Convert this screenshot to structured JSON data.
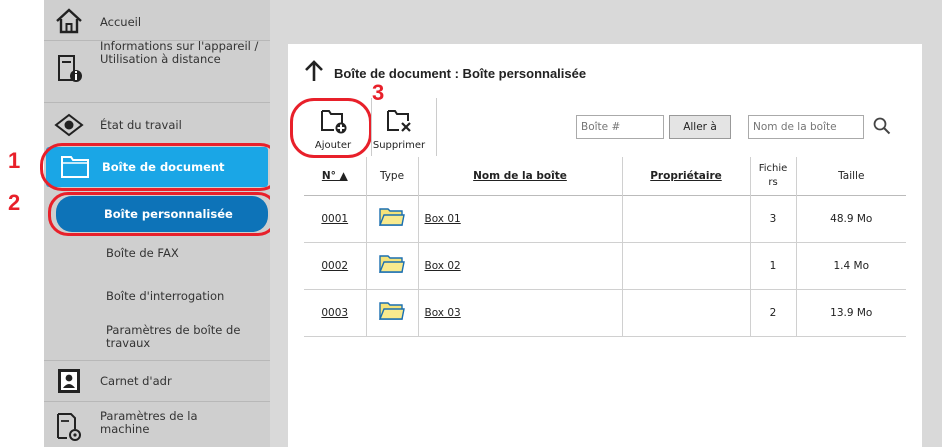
{
  "sidebar": {
    "home": "Accueil",
    "device_info": "Informations sur l'appareil / Utilisation à distance",
    "job_status": "État du travail",
    "document_box": "Boîte de document",
    "custom_box": "Boîte personnalisée",
    "fax_box": "Boîte de FAX",
    "polling_box": "Boîte d'interrogation",
    "job_box_settings": "Paramètres de boîte de travaux",
    "address_book": "Carnet d'adr",
    "machine_settings": "Paramètres de la machine"
  },
  "callouts": [
    "1",
    "2",
    "3"
  ],
  "main": {
    "title": "Boîte de document : Boîte personnalisée",
    "toolbar": {
      "add": "Ajouter",
      "delete": "Supprimer"
    },
    "box_number_placeholder": "Boîte #",
    "go_button": "Aller à",
    "box_name_placeholder": "Nom de la boîte"
  },
  "table": {
    "headers": {
      "number": "N° ▲",
      "type": "Type",
      "box_name": "Nom de la boîte",
      "owner": "Propriétaire",
      "files": "Fichie rs",
      "size": "Taille"
    },
    "rows": [
      {
        "number": "0001",
        "name": "Box 01",
        "owner": "",
        "files": "3",
        "size": "48.9 Mo"
      },
      {
        "number": "0002",
        "name": "Box 02",
        "owner": "",
        "files": "1",
        "size": "1.4 Mo"
      },
      {
        "number": "0003",
        "name": "Box 03",
        "owner": "",
        "files": "2",
        "size": "13.9 Mo"
      }
    ]
  },
  "colors": {
    "accent": "#1aa6e6",
    "accent_dark": "#0d73b8",
    "callout": "#e8202a",
    "folder": "#f4e37a"
  }
}
